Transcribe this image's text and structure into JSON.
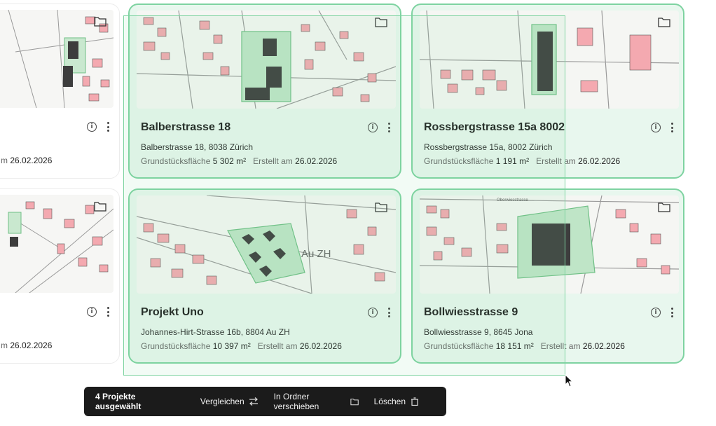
{
  "colors": {
    "accent": "#7ed3a1",
    "selected_bg": "#e8f7ee",
    "toolbar_bg": "#1b1b1b"
  },
  "cards": [
    {
      "title": "",
      "address": "",
      "area_label": "",
      "area_value": "",
      "created_label": "",
      "created_value": "26.02.2026",
      "selected": false
    },
    {
      "title": "Balberstrasse 18",
      "address": "Balberstrasse 18, 8038 Zürich",
      "area_label": "Grundstücksfläche",
      "area_value": "5 302 m²",
      "created_label": "Erstellt am",
      "created_value": "26.02.2026",
      "selected": true
    },
    {
      "title": "Rossbergstrasse 15a 8002",
      "address": "Rossbergstrasse 15a, 8002 Zürich",
      "area_label": "Grundstücksfläche",
      "area_value": "1 191 m²",
      "created_label": "Erstellt am",
      "created_value": "26.02.2026",
      "selected": true
    },
    {
      "title": "",
      "address": "",
      "area_label": "",
      "area_value": "",
      "created_label": "",
      "created_value": "26.02.2026",
      "selected": false
    },
    {
      "title": "Projekt Uno",
      "address": "Johannes-Hirt-Strasse 16b, 8804 Au ZH",
      "area_label": "Grundstücksfläche",
      "area_value": "10 397 m²",
      "created_label": "Erstellt am",
      "created_value": "26.02.2026",
      "selected": true
    },
    {
      "title": "Bollwiesstrasse 9",
      "address": "Bollwiesstrasse 9, 8645 Jona",
      "area_label": "Grundstücksfläche",
      "area_value": "18 151 m²",
      "created_label": "Erstellt am",
      "created_value": "26.02.2026",
      "selected": true
    }
  ],
  "partial_meta": {
    "prefix": "m"
  },
  "map_labels": {
    "projekt_uno": "Au ZH",
    "uno_street": "Oberwiesstrasse"
  },
  "toolbar": {
    "count": "4 Projekte ausgewählt",
    "compare": "Vergleichen",
    "move": "In Ordner verschieben",
    "delete": "Löschen"
  },
  "icons": {
    "folder": "folder-icon",
    "info": "info-icon",
    "more": "more-vertical-icon",
    "compare": "arrows-swap-icon",
    "move": "folder-icon",
    "delete": "trash-icon",
    "cursor": "mouse-pointer-icon"
  }
}
